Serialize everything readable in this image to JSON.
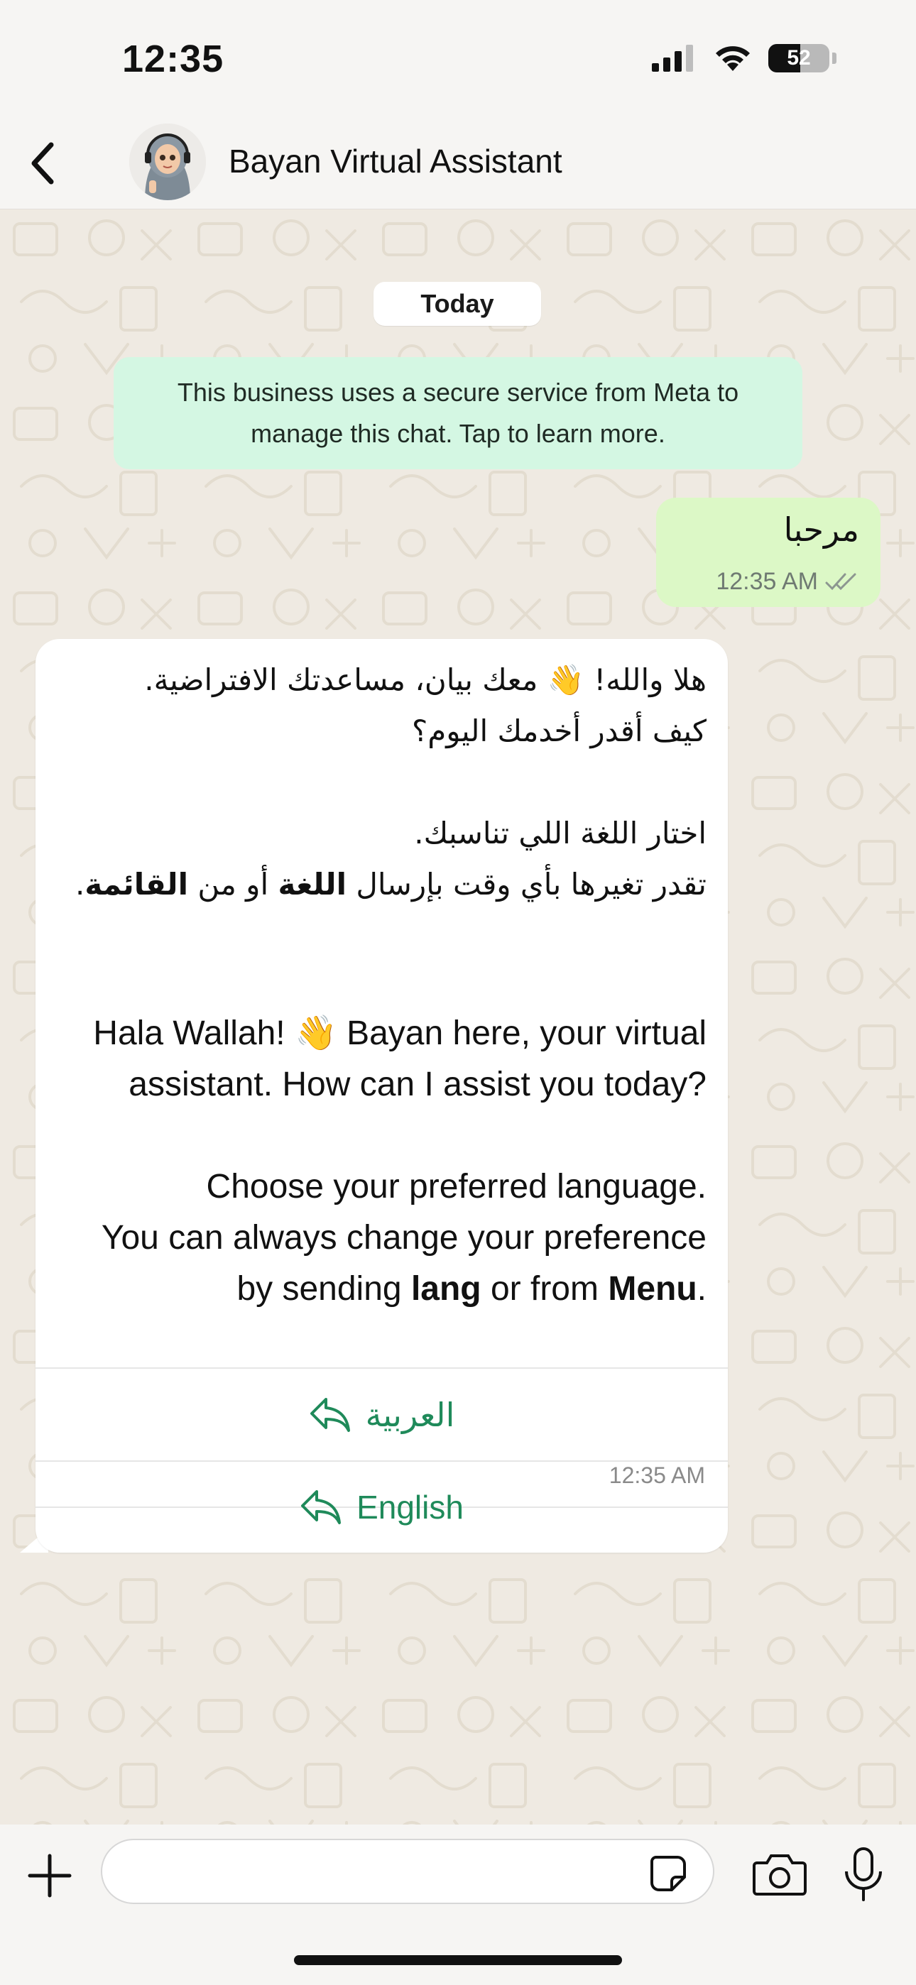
{
  "status_bar": {
    "time": "12:35",
    "battery": "52",
    "battery_level": 0.52
  },
  "header": {
    "title": "Bayan Virtual Assistant"
  },
  "chat": {
    "date_chip": "Today",
    "notice": "This business uses a secure service from Meta to manage this chat. Tap to learn more.",
    "outgoing": {
      "text": "مرحبا",
      "time": "12:35 AM",
      "status": "read"
    },
    "incoming": {
      "ar_line1": "هلا والله! 👋 معك بيان، مساعدتك الافتراضية.",
      "ar_line2": "كيف أقدر أخدمك اليوم؟",
      "ar_line3": "اختار اللغة اللي تناسبك.",
      "ar_line4_pre": "تقدر تغيرها بأي وقت بإرسال",
      "ar_line4_bold1": "اللغة",
      "ar_line4_mid": "أو من",
      "ar_line4_bold2": "القائمة",
      "ar_line4_end": ".",
      "en_para1": "Hala Wallah! 👋 Bayan here, your virtual assistant. How can I assist you today?",
      "en_line_choose": "Choose your preferred language.",
      "en_line_change": "You can always change your preference by sending",
      "en_bold_lang": "lang",
      "en_or_from": "or from",
      "en_bold_menu": "Menu",
      "en_period": ".",
      "time": "12:35 AM"
    },
    "quick_replies": [
      "العربية",
      "English"
    ]
  },
  "input": {
    "placeholder": ""
  },
  "colors": {
    "accent": "#1F8A5A",
    "outgoing_bubble": "#DCF8C6",
    "notice_bg": "#D4F7E3",
    "chat_bg": "#EFEAE2"
  }
}
